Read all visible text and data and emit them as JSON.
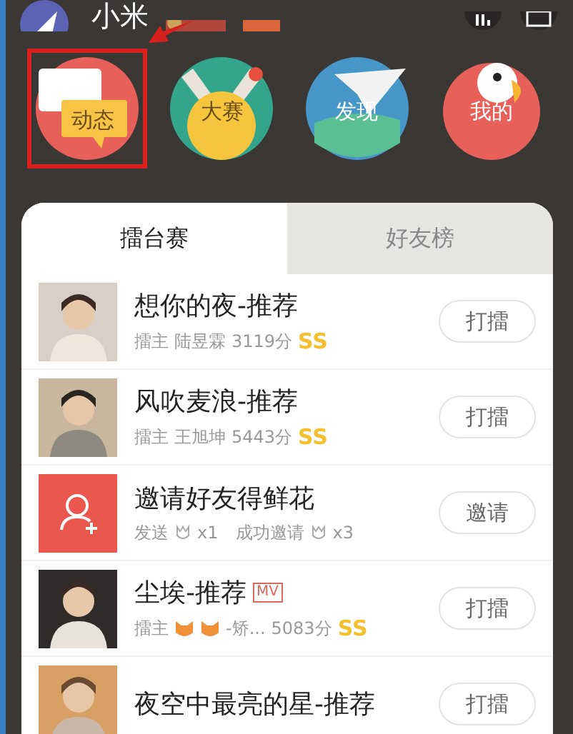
{
  "header": {
    "username": "小米"
  },
  "shortcuts": [
    {
      "label": "动态",
      "kind": "chat",
      "highlighted": true
    },
    {
      "label": "大赛",
      "kind": "medal",
      "highlighted": false
    },
    {
      "label": "发现",
      "kind": "plane",
      "highlighted": false
    },
    {
      "label": "我的",
      "kind": "bird",
      "highlighted": false
    }
  ],
  "tabs": [
    {
      "label": "擂台赛",
      "selected": true
    },
    {
      "label": "好友榜",
      "selected": false
    }
  ],
  "rows": [
    {
      "kind": "song",
      "title": "想你的夜-推荐",
      "role": "擂主",
      "owner": "陆昱霖",
      "score": "3119分",
      "rank": "SS",
      "button": "打擂"
    },
    {
      "kind": "song",
      "title": "风吹麦浪-推荐",
      "role": "擂主",
      "owner": "王旭坤",
      "score": "5443分",
      "rank": "SS",
      "button": "打擂"
    },
    {
      "kind": "invite",
      "title": "邀请好友得鲜花",
      "send": "发送",
      "send_count": "x1",
      "success": "成功邀请",
      "success_count": "x3",
      "button": "邀请"
    },
    {
      "kind": "song",
      "title": "尘埃-推荐",
      "tag": "MV",
      "role": "擂主",
      "owner_icons": [
        {
          "kind": "cat"
        },
        {
          "kind": "cat"
        }
      ],
      "owner": "-矫...",
      "score": "5083分",
      "rank": "SS",
      "button": "打擂"
    },
    {
      "kind": "song",
      "title": "夜空中最亮的星-推荐",
      "button": "打擂"
    }
  ]
}
